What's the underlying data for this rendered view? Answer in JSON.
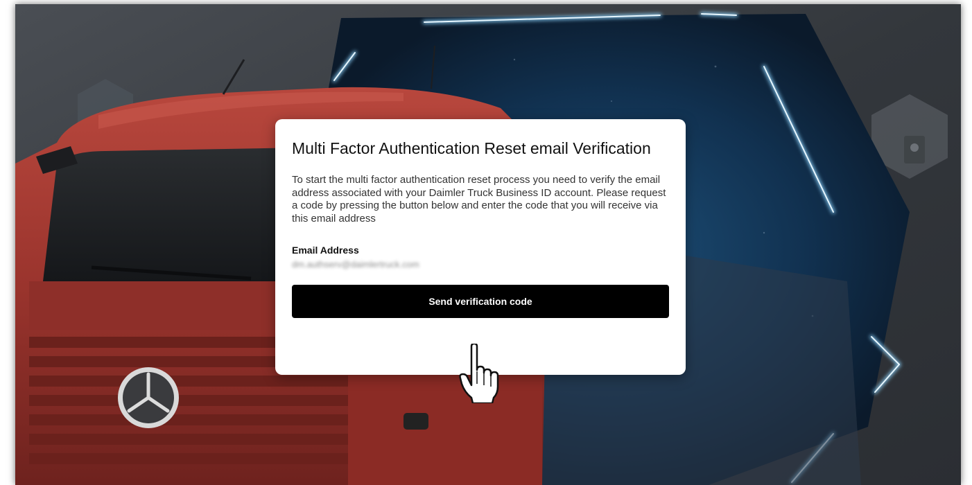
{
  "dialog": {
    "title": "Multi Factor Authentication Reset email Verification",
    "description": "To start the multi factor authentication reset process you need to verify the email address associated with your Daimler Truck Business ID account. Please request a code by pressing the button below and enter the code that you will receive via this email address",
    "email_label": "Email Address",
    "email_value": "dm.authserv@daimlertruck.com",
    "send_button_label": "Send verification code"
  },
  "colors": {
    "card_background": "#ffffff",
    "button_background": "#000000",
    "button_text": "#ffffff",
    "truck_red": "#a33a32",
    "neon_blue": "#3fb6ff"
  },
  "icons": {
    "pointer": "hand-pointer-icon"
  }
}
